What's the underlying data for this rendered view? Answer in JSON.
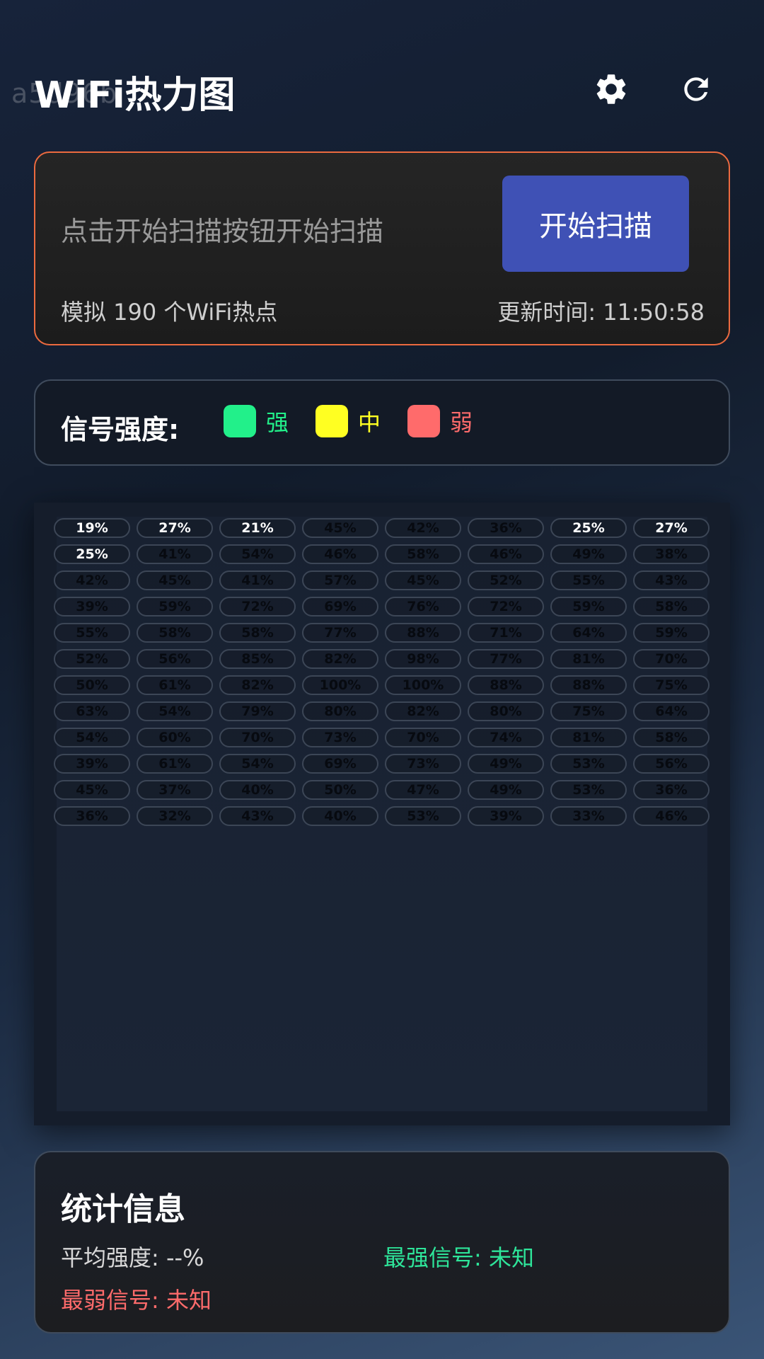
{
  "watermark": "a5d96b",
  "header": {
    "title": "WiFi热力图"
  },
  "scan": {
    "status_text": "点击开始扫描按钮开始扫描",
    "button_label": "开始扫描",
    "sim_count": "模拟 190 个WiFi热点",
    "update_time": "更新时间: 11:50:58"
  },
  "legend": {
    "title": "信号强度:",
    "items": [
      {
        "label": "强",
        "color": "#22f08a"
      },
      {
        "label": "中",
        "color": "#ffff22"
      },
      {
        "label": "弱",
        "color": "#ff6b6b"
      }
    ]
  },
  "heatmap": {
    "rows": [
      [
        "19%",
        "27%",
        "21%",
        "45%",
        "42%",
        "36%",
        "25%",
        "27%"
      ],
      [
        "25%",
        "41%",
        "54%",
        "46%",
        "58%",
        "46%",
        "49%",
        "38%"
      ],
      [
        "42%",
        "45%",
        "41%",
        "57%",
        "45%",
        "52%",
        "55%",
        "43%"
      ],
      [
        "39%",
        "59%",
        "72%",
        "69%",
        "76%",
        "72%",
        "59%",
        "58%"
      ],
      [
        "55%",
        "58%",
        "58%",
        "77%",
        "88%",
        "71%",
        "64%",
        "59%"
      ],
      [
        "52%",
        "56%",
        "85%",
        "82%",
        "98%",
        "77%",
        "81%",
        "70%"
      ],
      [
        "50%",
        "61%",
        "82%",
        "100%",
        "100%",
        "88%",
        "88%",
        "75%"
      ],
      [
        "63%",
        "54%",
        "79%",
        "80%",
        "82%",
        "80%",
        "75%",
        "64%"
      ],
      [
        "54%",
        "60%",
        "70%",
        "73%",
        "70%",
        "74%",
        "81%",
        "58%"
      ],
      [
        "39%",
        "61%",
        "54%",
        "69%",
        "73%",
        "49%",
        "53%",
        "56%"
      ],
      [
        "45%",
        "37%",
        "40%",
        "50%",
        "47%",
        "49%",
        "53%",
        "36%"
      ],
      [
        "36%",
        "32%",
        "43%",
        "40%",
        "53%",
        "39%",
        "33%",
        "46%"
      ]
    ],
    "highlighted": [
      [
        0,
        0
      ],
      [
        0,
        1
      ],
      [
        0,
        2
      ],
      [
        0,
        6
      ],
      [
        0,
        7
      ],
      [
        1,
        0
      ]
    ]
  },
  "stats": {
    "title": "统计信息",
    "avg": "平均强度: --%",
    "strongest": "最强信号: 未知",
    "weakest": "最弱信号: 未知"
  },
  "colors": {
    "accent": "#3f51b5",
    "card_border": "#ec6a3f",
    "strong": "#2ee59a",
    "weak": "#ff6b6b"
  }
}
